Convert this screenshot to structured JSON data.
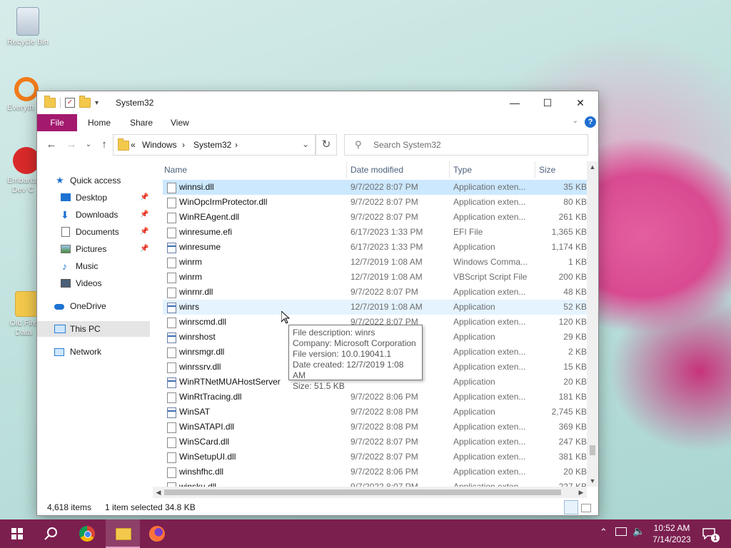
{
  "desktop": {
    "icons": [
      {
        "label": "Recycle Bin"
      },
      {
        "label": "Everyth"
      },
      {
        "label": "Embarca Dev C"
      },
      {
        "label": "Old Fire Data"
      }
    ]
  },
  "window": {
    "title": "System32",
    "ribbon": {
      "file": "File",
      "tabs": [
        "Home",
        "Share",
        "View"
      ],
      "help": "?"
    },
    "address": {
      "crumbs": [
        "«",
        "Windows",
        "›",
        "System32",
        "›"
      ]
    },
    "search": {
      "placeholder": "Search System32"
    },
    "nav": {
      "quick_access": "Quick access",
      "items": [
        "Desktop",
        "Downloads",
        "Documents",
        "Pictures",
        "Music",
        "Videos"
      ],
      "onedrive": "OneDrive",
      "this_pc": "This PC",
      "network": "Network"
    },
    "columns": {
      "name": "Name",
      "date": "Date modified",
      "type": "Type",
      "size": "Size"
    },
    "files": [
      {
        "name": "winnsi.dll",
        "date": "9/7/2022 8:07 PM",
        "type": "Application exten...",
        "size": "35 KB"
      },
      {
        "name": "WinOpcIrmProtector.dll",
        "date": "9/7/2022 8:07 PM",
        "type": "Application exten...",
        "size": "80 KB"
      },
      {
        "name": "WinREAgent.dll",
        "date": "9/7/2022 8:07 PM",
        "type": "Application exten...",
        "size": "261 KB"
      },
      {
        "name": "winresume.efi",
        "date": "6/17/2023 1:33 PM",
        "type": "EFI File",
        "size": "1,365 KB"
      },
      {
        "name": "winresume",
        "date": "6/17/2023 1:33 PM",
        "type": "Application",
        "size": "1,174 KB"
      },
      {
        "name": "winrm",
        "date": "12/7/2019 1:08 AM",
        "type": "Windows Comma...",
        "size": "1 KB"
      },
      {
        "name": "winrm",
        "date": "12/7/2019 1:08 AM",
        "type": "VBScript Script File",
        "size": "200 KB"
      },
      {
        "name": "winrnr.dll",
        "date": "9/7/2022 8:07 PM",
        "type": "Application exten...",
        "size": "48 KB"
      },
      {
        "name": "winrs",
        "date": "12/7/2019 1:08 AM",
        "type": "Application",
        "size": "52 KB"
      },
      {
        "name": "winrscmd.dll",
        "date": "9/7/2022 8:07 PM",
        "type": "Application exten...",
        "size": "120 KB"
      },
      {
        "name": "winrshost",
        "date": "",
        "type": "Application",
        "size": "29 KB"
      },
      {
        "name": "winrsmgr.dll",
        "date": "",
        "type": "Application exten...",
        "size": "2 KB"
      },
      {
        "name": "winrssrv.dll",
        "date": "",
        "type": "Application exten...",
        "size": "15 KB"
      },
      {
        "name": "WinRTNetMUAHostServer",
        "date": "",
        "type": "Application",
        "size": "20 KB"
      },
      {
        "name": "WinRtTracing.dll",
        "date": "9/7/2022 8:06 PM",
        "type": "Application exten...",
        "size": "181 KB"
      },
      {
        "name": "WinSAT",
        "date": "9/7/2022 8:08 PM",
        "type": "Application",
        "size": "2,745 KB"
      },
      {
        "name": "WinSATAPI.dll",
        "date": "9/7/2022 8:08 PM",
        "type": "Application exten...",
        "size": "369 KB"
      },
      {
        "name": "WinSCard.dll",
        "date": "9/7/2022 8:07 PM",
        "type": "Application exten...",
        "size": "247 KB"
      },
      {
        "name": "WinSetupUI.dll",
        "date": "9/7/2022 8:07 PM",
        "type": "Application exten...",
        "size": "381 KB"
      },
      {
        "name": "winshfhc.dll",
        "date": "9/7/2022 8:06 PM",
        "type": "Application exten...",
        "size": "20 KB"
      },
      {
        "name": "winsku.dll",
        "date": "9/7/2022 8:07 PM",
        "type": "Application exten...",
        "size": "227 KB"
      }
    ],
    "tooltip": [
      "File description: winrs",
      "Company: Microsoft Corporation",
      "File version: 10.0.19041.1",
      "Date created: 12/7/2019 1:08 AM",
      "Size: 51.5 KB"
    ],
    "status": {
      "items": "4,618 items",
      "selected": "1 item selected",
      "size": "34.8 KB"
    }
  },
  "taskbar": {
    "time": "10:52 AM",
    "date": "7/14/2023",
    "notifications": "1"
  },
  "colors": {
    "accent": "#a3196e",
    "taskbar": "#7b1f4f",
    "selection": "#cce8ff"
  }
}
